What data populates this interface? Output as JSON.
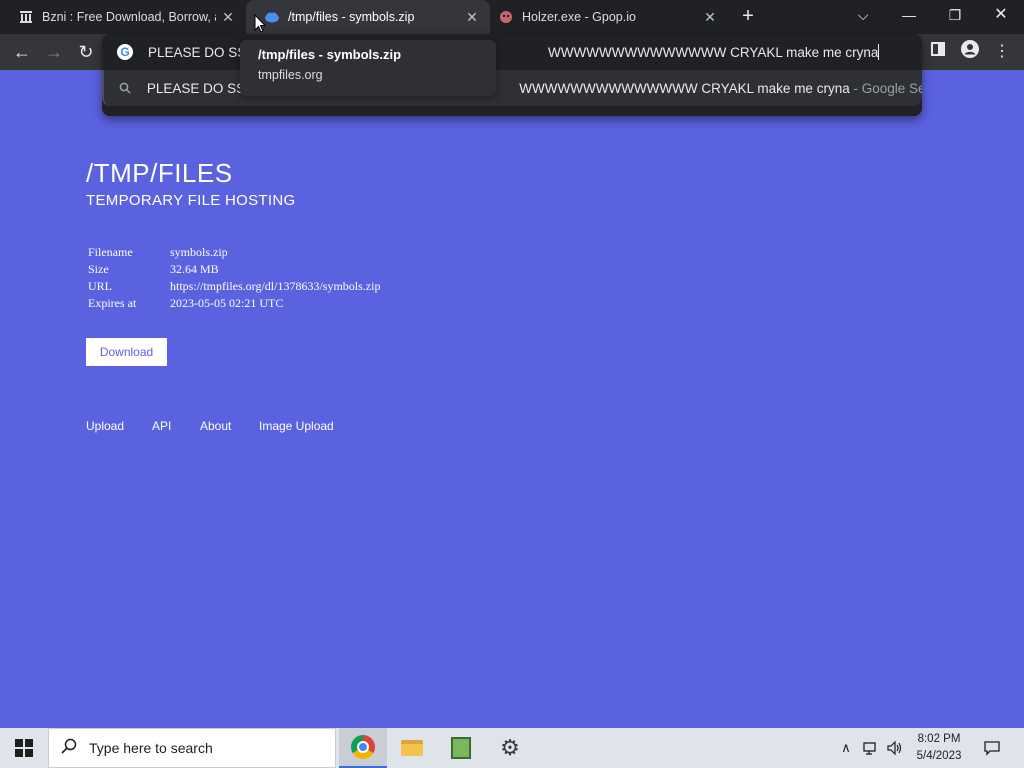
{
  "browser": {
    "tabs": [
      {
        "title": "Bzni : Free Download, Borrow, and",
        "favicon": "archive-icon"
      },
      {
        "title": "/tmp/files - symbols.zip",
        "favicon": "cloud-icon",
        "active": true
      },
      {
        "title": "Holzer.exe - Gpop.io",
        "favicon": "gpop-icon"
      }
    ],
    "omnibox": {
      "typed_text_start": "PLEASE DO SS",
      "typed_text_end": "WWWWWWWWWWWWWW CRYAKL make me cryna",
      "suggestion_start": "PLEASE DO SS",
      "suggestion_end": "WWWWWWWWWWWWWW CRYAKL make me cryna",
      "suggestion_suffix": "- Google Search"
    },
    "tooltip": {
      "title": "/tmp/files - symbols.zip",
      "host": "tmpfiles.org"
    }
  },
  "page": {
    "title": "/TMP/FILES",
    "subtitle": "TEMPORARY FILE HOSTING",
    "info": [
      {
        "label": "Filename",
        "value": "symbols.zip"
      },
      {
        "label": "Size",
        "value": "32.64 MB"
      },
      {
        "label": "URL",
        "value": "https://tmpfiles.org/dl/1378633/symbols.zip"
      },
      {
        "label": "Expires at",
        "value": "2023-05-05 02:21 UTC"
      }
    ],
    "download_label": "Download",
    "footer_links": [
      "Upload",
      "API",
      "About",
      "Image Upload"
    ]
  },
  "taskbar": {
    "search_placeholder": "Type here to search",
    "time": "8:02 PM",
    "date": "5/4/2023"
  },
  "colors": {
    "page_bg": "#5b62e0",
    "chrome_dark": "#202124",
    "chrome_toolbar": "#35363a"
  }
}
